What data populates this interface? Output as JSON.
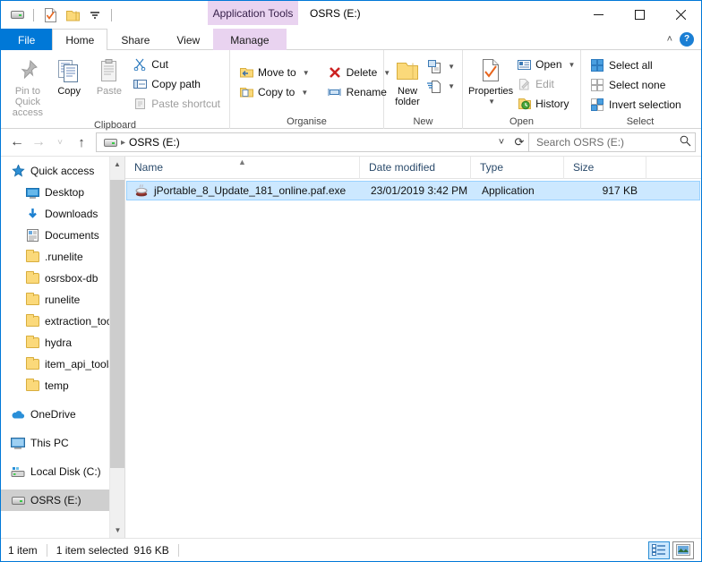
{
  "window": {
    "title": "OSRS (E:)",
    "contextual_tab_header": "Application Tools",
    "minimize": "—",
    "maximize": "☐",
    "close": "✕"
  },
  "quick_access_toolbar": {
    "items": [
      {
        "name": "drive-icon",
        "label": "OSRS (E:)"
      },
      {
        "name": "properties-icon",
        "label": "Properties"
      },
      {
        "name": "new-folder-icon",
        "label": "New folder"
      },
      {
        "name": "customize-dropdown-icon",
        "label": "Customise Quick Access Toolbar"
      }
    ]
  },
  "tabs": [
    {
      "id": "file",
      "label": "File",
      "active": false
    },
    {
      "id": "home",
      "label": "Home",
      "active": true
    },
    {
      "id": "share",
      "label": "Share",
      "active": false
    },
    {
      "id": "view",
      "label": "View",
      "active": false
    },
    {
      "id": "manage",
      "label": "Manage",
      "active": false,
      "contextual": true
    }
  ],
  "ribbon_controls": {
    "collapse_label": "˄",
    "help_label": "?"
  },
  "ribbon": {
    "groups": [
      {
        "label": "Clipboard",
        "big_buttons": [
          {
            "label": "Pin to Quick\naccess",
            "line1": "Pin to Quick",
            "line2": "access",
            "icon": "pin-icon",
            "disabled": false
          },
          {
            "label": "Copy",
            "line1": "Copy",
            "line2": "",
            "icon": "copy-icon",
            "disabled": false
          },
          {
            "label": "Paste",
            "line1": "Paste",
            "line2": "",
            "icon": "paste-icon",
            "disabled": true
          }
        ],
        "small_buttons": [
          {
            "label": "Cut",
            "icon": "scissors-icon",
            "disabled": false,
            "caret": false
          },
          {
            "label": "Copy path",
            "icon": "copy-path-icon",
            "disabled": false,
            "caret": false
          },
          {
            "label": "Paste shortcut",
            "icon": "paste-shortcut-icon",
            "disabled": true,
            "caret": false
          }
        ]
      },
      {
        "label": "Organise",
        "small_buttons": [
          {
            "label": "Move to",
            "icon": "move-to-icon",
            "disabled": false,
            "caret": true
          },
          {
            "label": "Copy to",
            "icon": "copy-to-icon",
            "disabled": false,
            "caret": true
          },
          {
            "label": "Delete",
            "icon": "delete-icon",
            "disabled": false,
            "caret": true
          },
          {
            "label": "Rename",
            "icon": "rename-icon",
            "disabled": false,
            "caret": false
          }
        ]
      },
      {
        "label": "New",
        "big_buttons": [
          {
            "line1": "New",
            "line2": "folder",
            "icon": "new-folder-icon",
            "disabled": false
          }
        ],
        "small_buttons": [
          {
            "label": "",
            "icon": "new-item-icon",
            "disabled": false,
            "caret": true
          },
          {
            "label": "",
            "icon": "easy-access-icon",
            "disabled": false,
            "caret": true
          }
        ]
      },
      {
        "label": "Open",
        "big_buttons": [
          {
            "line1": "Properties",
            "line2": "",
            "icon": "properties-icon",
            "disabled": false,
            "caret": true
          }
        ],
        "small_buttons": [
          {
            "label": "Open",
            "icon": "open-icon",
            "disabled": false,
            "caret": true
          },
          {
            "label": "Edit",
            "icon": "edit-icon",
            "disabled": true,
            "caret": false
          },
          {
            "label": "History",
            "icon": "history-icon",
            "disabled": false,
            "caret": false
          }
        ]
      },
      {
        "label": "Select",
        "small_buttons": [
          {
            "label": "Select all",
            "icon": "select-all-icon",
            "disabled": false,
            "caret": false
          },
          {
            "label": "Select none",
            "icon": "select-none-icon",
            "disabled": false,
            "caret": false
          },
          {
            "label": "Invert selection",
            "icon": "invert-selection-icon",
            "disabled": false,
            "caret": false
          }
        ]
      }
    ]
  },
  "navbar": {
    "back": "←",
    "forward": "→",
    "recent": "˅",
    "up": "↑",
    "breadcrumb": [
      {
        "icon": "drive-icon",
        "label": "OSRS (E:)"
      }
    ],
    "dropdown": "˅",
    "refresh": "⟳",
    "search_placeholder": "Search OSRS (E:)",
    "search_value": ""
  },
  "navigation_pane": {
    "items": [
      {
        "label": "Quick access",
        "icon": "quick-access-star-icon",
        "indent": false,
        "pinned": false,
        "selected": false
      },
      {
        "label": "Desktop",
        "icon": "desktop-icon",
        "indent": true,
        "pinned": true,
        "selected": false
      },
      {
        "label": "Downloads",
        "icon": "downloads-icon",
        "indent": true,
        "pinned": true,
        "selected": false
      },
      {
        "label": "Documents",
        "icon": "documents-icon",
        "indent": true,
        "pinned": true,
        "selected": false
      },
      {
        "label": ".runelite",
        "icon": "folder-icon",
        "indent": true,
        "pinned": true,
        "selected": false
      },
      {
        "label": "osrsbox-db",
        "icon": "folder-icon",
        "indent": true,
        "pinned": true,
        "selected": false
      },
      {
        "label": "runelite",
        "icon": "folder-icon",
        "indent": true,
        "pinned": true,
        "selected": false
      },
      {
        "label": "extraction_tools_",
        "icon": "folder-icon",
        "indent": true,
        "pinned": false,
        "selected": false
      },
      {
        "label": "hydra",
        "icon": "folder-icon",
        "indent": true,
        "pinned": false,
        "selected": false
      },
      {
        "label": "item_api_tools",
        "icon": "folder-icon",
        "indent": true,
        "pinned": false,
        "selected": false
      },
      {
        "label": "temp",
        "icon": "folder-icon",
        "indent": true,
        "pinned": false,
        "selected": false
      },
      {
        "label": "OneDrive",
        "icon": "onedrive-icon",
        "indent": false,
        "pinned": false,
        "selected": false
      },
      {
        "label": "This PC",
        "icon": "this-pc-icon",
        "indent": false,
        "pinned": false,
        "selected": false
      },
      {
        "label": "Local Disk (C:)",
        "icon": "local-disk-icon",
        "indent": false,
        "pinned": false,
        "selected": false
      },
      {
        "label": "OSRS (E:)",
        "icon": "drive-icon",
        "indent": false,
        "pinned": false,
        "selected": true
      }
    ]
  },
  "file_list": {
    "columns": [
      {
        "key": "name",
        "label": "Name",
        "sorted": true,
        "sort_dir": "asc"
      },
      {
        "key": "date",
        "label": "Date modified",
        "sorted": false
      },
      {
        "key": "type",
        "label": "Type",
        "sorted": false
      },
      {
        "key": "size",
        "label": "Size",
        "sorted": false
      }
    ],
    "rows": [
      {
        "name": "jPortable_8_Update_181_online.paf.exe",
        "date": "23/01/2019 3:42 PM",
        "type": "Application",
        "size": "917 KB",
        "icon": "java-installer-icon",
        "selected": true
      }
    ]
  },
  "status_bar": {
    "item_count": "1 item",
    "selection_info": "1 item selected",
    "selection_size": "916 KB",
    "view_details_label": "Details view",
    "view_large_icons_label": "Large icons view"
  },
  "colors": {
    "accent": "#0078d7",
    "selection": "#cce8ff",
    "contextual_tab": "#e9d3f0",
    "folder_yellow": "#fbd97a"
  }
}
